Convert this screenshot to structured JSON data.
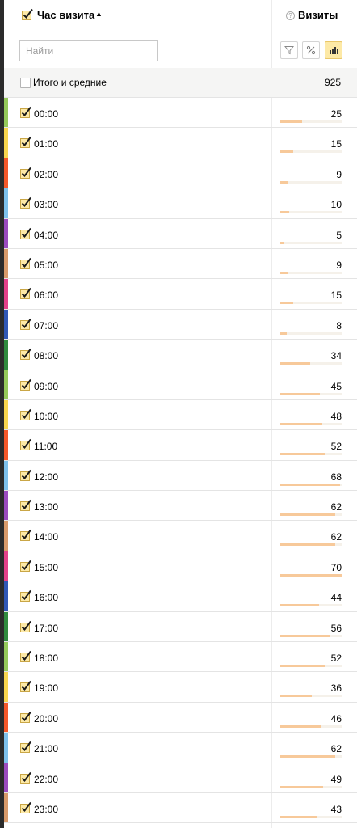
{
  "header": {
    "column_title": "Час визита",
    "sort_indicator": "▲",
    "metric_title": "Визиты",
    "help_glyph": "?"
  },
  "search": {
    "placeholder": "Найти",
    "value": ""
  },
  "toolbar": {
    "active_tool": "bar-chart"
  },
  "totals": {
    "label": "Итого и средние",
    "value": "925"
  },
  "colors": {
    "accent_fill": "#f7c99a",
    "active_button": "#fde9a6",
    "checkmark": "#1a1a1a",
    "checkbox_fill": "#fde9a6"
  },
  "rows": [
    {
      "label": "00:00",
      "value": "25",
      "bar_fraction": 0.36,
      "color": "#95c95a"
    },
    {
      "label": "01:00",
      "value": "15",
      "bar_fraction": 0.21,
      "color": "#f8d64e"
    },
    {
      "label": "02:00",
      "value": "9",
      "bar_fraction": 0.13,
      "color": "#f4582a"
    },
    {
      "label": "03:00",
      "value": "10",
      "bar_fraction": 0.14,
      "color": "#7ec1ec"
    },
    {
      "label": "04:00",
      "value": "5",
      "bar_fraction": 0.07,
      "color": "#9b4bbf"
    },
    {
      "label": "05:00",
      "value": "9",
      "bar_fraction": 0.13,
      "color": "#d89a6a"
    },
    {
      "label": "06:00",
      "value": "15",
      "bar_fraction": 0.21,
      "color": "#e4418a"
    },
    {
      "label": "07:00",
      "value": "8",
      "bar_fraction": 0.11,
      "color": "#2f57b5"
    },
    {
      "label": "08:00",
      "value": "34",
      "bar_fraction": 0.49,
      "color": "#2f8a3e"
    },
    {
      "label": "09:00",
      "value": "45",
      "bar_fraction": 0.64,
      "color": "#95c95a"
    },
    {
      "label": "10:00",
      "value": "48",
      "bar_fraction": 0.69,
      "color": "#f8d64e"
    },
    {
      "label": "11:00",
      "value": "52",
      "bar_fraction": 0.74,
      "color": "#f4582a"
    },
    {
      "label": "12:00",
      "value": "68",
      "bar_fraction": 0.97,
      "color": "#7ec1ec"
    },
    {
      "label": "13:00",
      "value": "62",
      "bar_fraction": 0.89,
      "color": "#9b4bbf"
    },
    {
      "label": "14:00",
      "value": "62",
      "bar_fraction": 0.89,
      "color": "#d89a6a"
    },
    {
      "label": "15:00",
      "value": "70",
      "bar_fraction": 1.0,
      "color": "#e4418a"
    },
    {
      "label": "16:00",
      "value": "44",
      "bar_fraction": 0.63,
      "color": "#2f57b5"
    },
    {
      "label": "17:00",
      "value": "56",
      "bar_fraction": 0.8,
      "color": "#2f8a3e"
    },
    {
      "label": "18:00",
      "value": "52",
      "bar_fraction": 0.74,
      "color": "#95c95a"
    },
    {
      "label": "19:00",
      "value": "36",
      "bar_fraction": 0.51,
      "color": "#f8d64e"
    },
    {
      "label": "20:00",
      "value": "46",
      "bar_fraction": 0.66,
      "color": "#f4582a"
    },
    {
      "label": "21:00",
      "value": "62",
      "bar_fraction": 0.89,
      "color": "#7ec1ec"
    },
    {
      "label": "22:00",
      "value": "49",
      "bar_fraction": 0.7,
      "color": "#9b4bbf"
    },
    {
      "label": "23:00",
      "value": "43",
      "bar_fraction": 0.61,
      "color": "#d89a6a"
    }
  ]
}
